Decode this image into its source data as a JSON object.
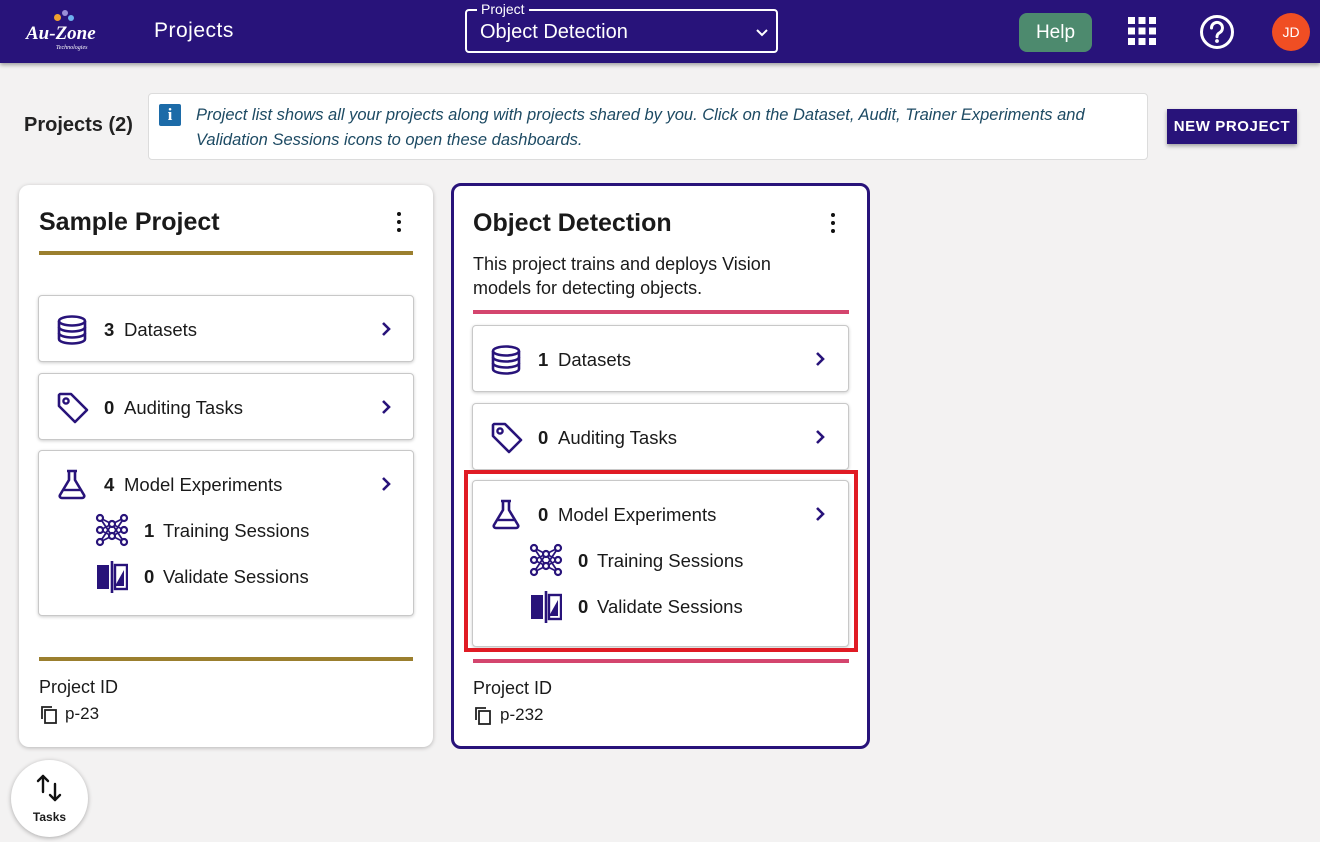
{
  "app": {
    "logo_text": "Au-Zone",
    "logo_subtext": "Technologies",
    "section_title": "Projects"
  },
  "project_select": {
    "legend": "Project",
    "value": "Object Detection"
  },
  "topbar": {
    "help_label": "Help",
    "avatar_initials": "JD"
  },
  "header": {
    "projects_count": "Projects (2)",
    "info_text": "Project list shows all your projects along with projects shared by you. Click on the Dataset, Audit, Trainer Experiments and Validation Sessions icons to open these dashboards.",
    "new_project_label": "NEW PROJECT"
  },
  "colors": {
    "brand": "#28137a",
    "help_button": "#4d8a6e",
    "avatar": "#f04e23",
    "sample_rule": "#9b7f2e",
    "object_rule": "#d4456e",
    "highlight": "#e01b24"
  },
  "cards": [
    {
      "title": "Sample Project",
      "description": "",
      "datasets_count": "3",
      "datasets_label": "Datasets",
      "auditing_count": "0",
      "auditing_label": "Auditing Tasks",
      "experiments_count": "4",
      "experiments_label": "Model Experiments",
      "training_count": "1",
      "training_label": "Training Sessions",
      "validate_count": "0",
      "validate_label": "Validate Sessions",
      "project_id_label": "Project ID",
      "project_id": "p-23"
    },
    {
      "title": "Object Detection",
      "description": "This project trains and deploys Vision models for detecting objects.",
      "datasets_count": "1",
      "datasets_label": "Datasets",
      "auditing_count": "0",
      "auditing_label": "Auditing Tasks",
      "experiments_count": "0",
      "experiments_label": "Model Experiments",
      "training_count": "0",
      "training_label": "Training Sessions",
      "validate_count": "0",
      "validate_label": "Validate Sessions",
      "project_id_label": "Project ID",
      "project_id": "p-232"
    }
  ],
  "tasks_fab": {
    "label": "Tasks"
  },
  "icons": [
    "au-zone-logo",
    "chevron-down-icon",
    "apps-grid-icon",
    "help-circle-icon",
    "info-icon",
    "more-vert-icon",
    "database-icon",
    "tag-icon",
    "flask-icon",
    "network-icon",
    "compare-icon",
    "chevron-right-icon",
    "copy-icon",
    "swap-vert-icon"
  ]
}
